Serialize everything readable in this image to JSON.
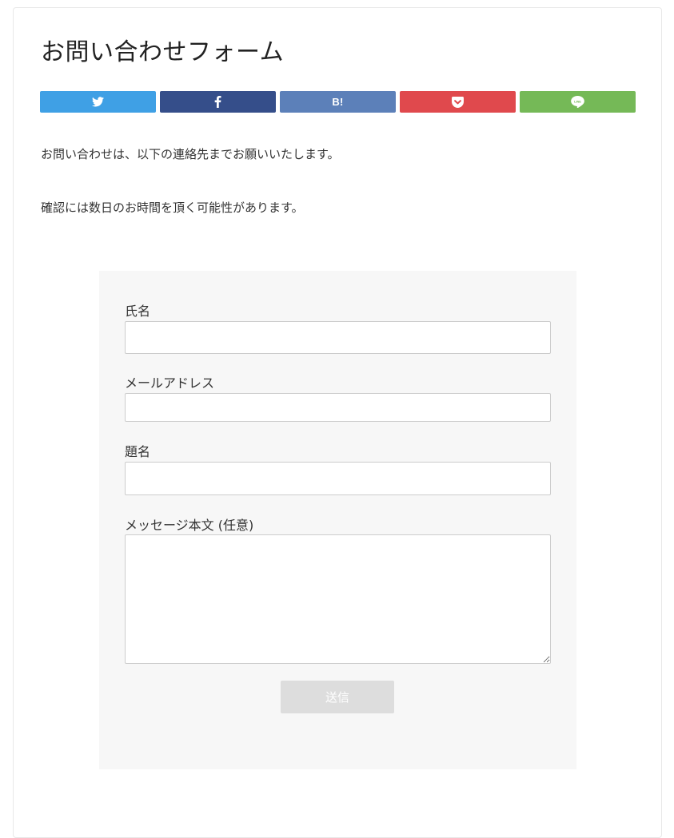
{
  "page": {
    "title": "お問い合わせフォーム",
    "intro": [
      "お問い合わせは、以下の連絡先までお願いいたします。",
      "確認には数日のお時間を頂く可能性があります。"
    ]
  },
  "share_buttons": [
    {
      "name": "twitter",
      "icon": "twitter-bird-icon",
      "color": "#3fa0e5"
    },
    {
      "name": "facebook",
      "icon": "facebook-f-icon",
      "color": "#354e8a"
    },
    {
      "name": "hatena",
      "icon": "hatena-bookmark-icon",
      "label": "B!",
      "color": "#5c80b9"
    },
    {
      "name": "pocket",
      "icon": "pocket-icon",
      "color": "#e0494d"
    },
    {
      "name": "line",
      "icon": "line-icon",
      "label": "LINE",
      "color": "#75b957"
    }
  ],
  "form": {
    "fields": [
      {
        "label": "氏名",
        "value": ""
      },
      {
        "label": "メールアドレス",
        "value": ""
      },
      {
        "label": "題名",
        "value": ""
      },
      {
        "label": "メッセージ本文 (任意)",
        "value": ""
      }
    ],
    "submit_label": "送信"
  }
}
